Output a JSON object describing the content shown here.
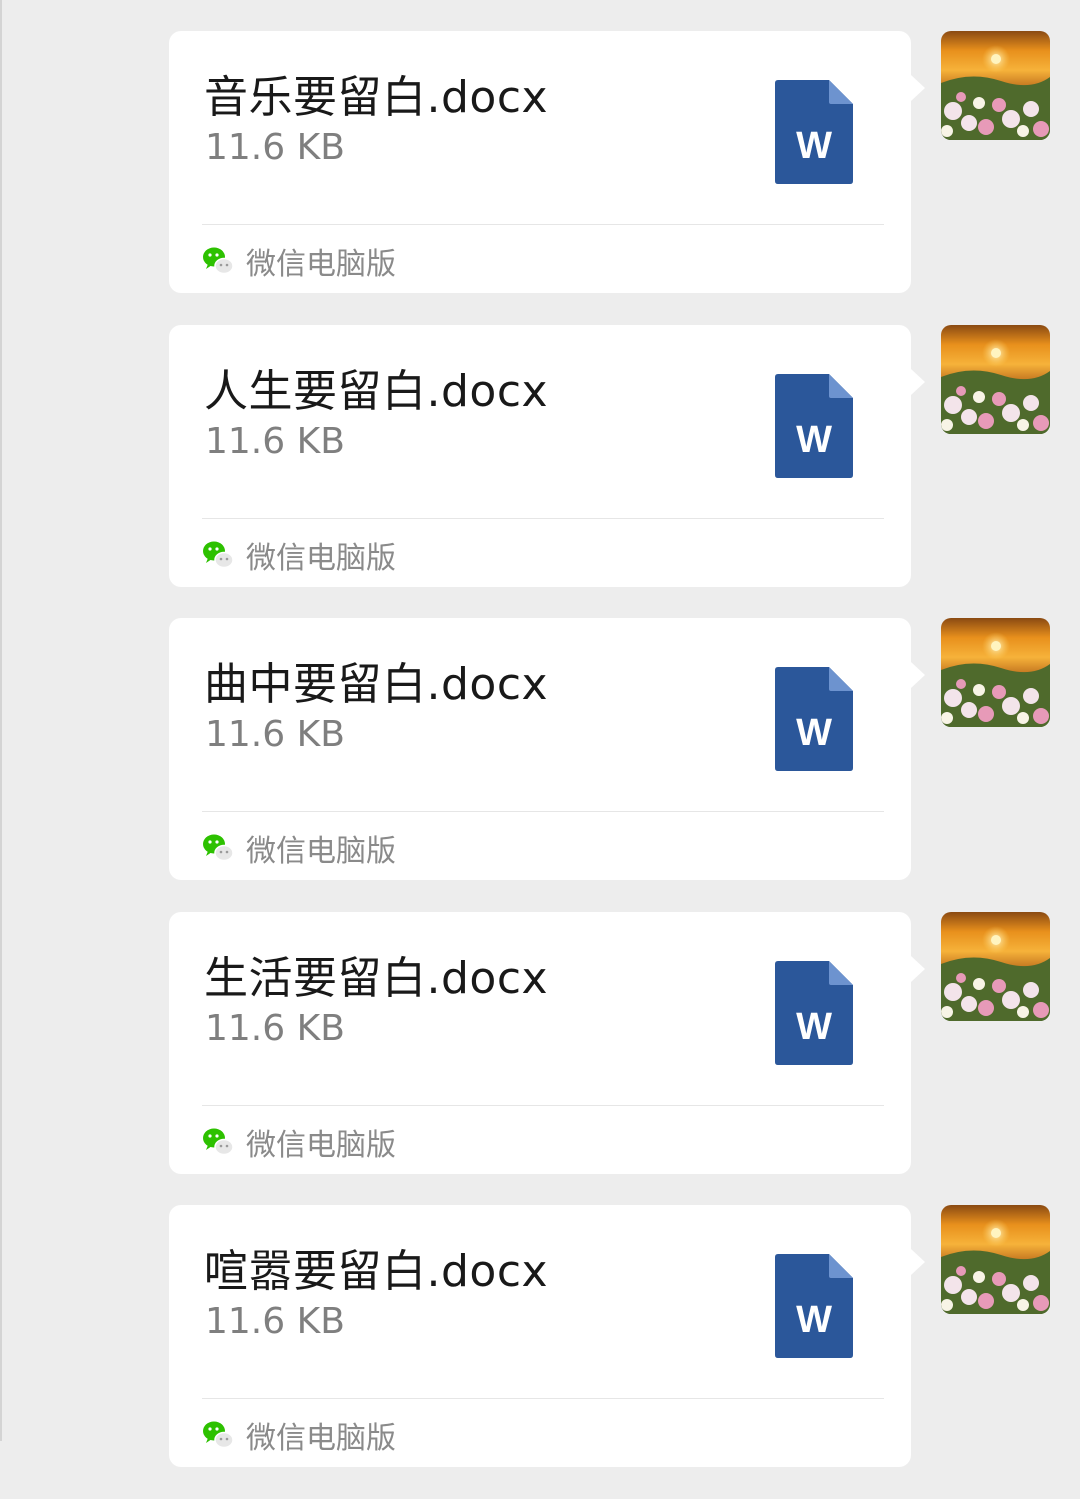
{
  "messages": [
    {
      "file_name": "音乐要留白.docx",
      "file_size": "11.6 KB",
      "source": "微信电脑版",
      "file_type": "W"
    },
    {
      "file_name": "人生要留白.docx",
      "file_size": "11.6 KB",
      "source": "微信电脑版",
      "file_type": "W"
    },
    {
      "file_name": "曲中要留白.docx",
      "file_size": "11.6 KB",
      "source": "微信电脑版",
      "file_type": "W"
    },
    {
      "file_name": "生活要留白.docx",
      "file_size": "11.6 KB",
      "source": "微信电脑版",
      "file_type": "W"
    },
    {
      "file_name": "喧嚣要留白.docx",
      "file_size": "11.6 KB",
      "source": "微信电脑版",
      "file_type": "W"
    }
  ],
  "icons": {
    "file": "word-document-icon",
    "source": "wechat-icon",
    "sender": "avatar-flowers-sunset"
  },
  "colors": {
    "background": "#ededed",
    "bubble": "#ffffff",
    "word_blue": "#2b579a",
    "wechat_green": "#07c160"
  }
}
